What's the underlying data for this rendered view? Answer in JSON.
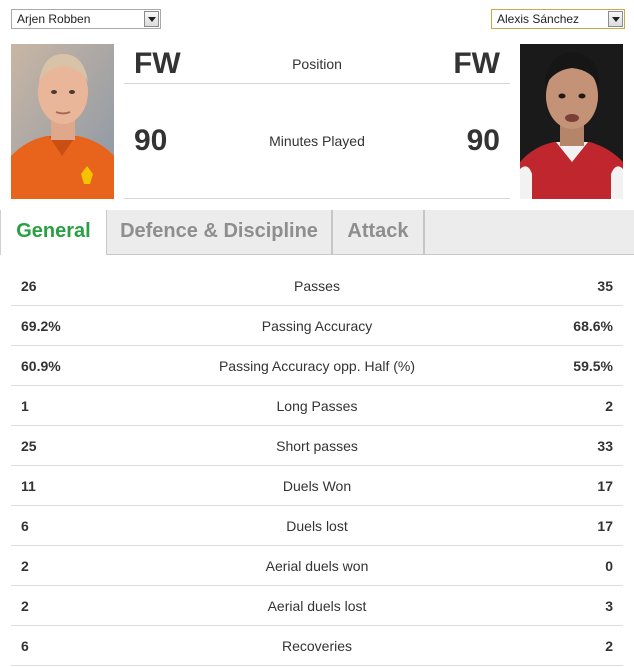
{
  "players": {
    "left": {
      "name": "Arjen Robben"
    },
    "right": {
      "name": "Alexis Sánchez"
    }
  },
  "comparison": [
    {
      "label": "Position",
      "left": "FW",
      "right": "FW"
    },
    {
      "label": "Minutes Played",
      "left": "90",
      "right": "90"
    }
  ],
  "tabs": [
    {
      "label": "General",
      "active": true
    },
    {
      "label": "Defence & Discipline",
      "active": false
    },
    {
      "label": "Attack",
      "active": false
    }
  ],
  "stats": [
    {
      "label": "Passes",
      "left": "26",
      "right": "35"
    },
    {
      "label": "Passing Accuracy",
      "left": "69.2%",
      "right": "68.6%"
    },
    {
      "label": "Passing Accuracy opp. Half (%)",
      "left": "60.9%",
      "right": "59.5%"
    },
    {
      "label": "Long Passes",
      "left": "1",
      "right": "2"
    },
    {
      "label": "Short passes",
      "left": "25",
      "right": "33"
    },
    {
      "label": "Duels Won",
      "left": "11",
      "right": "17"
    },
    {
      "label": "Duels lost",
      "left": "6",
      "right": "17"
    },
    {
      "label": "Aerial duels won",
      "left": "2",
      "right": "0"
    },
    {
      "label": "Aerial duels lost",
      "left": "2",
      "right": "3"
    },
    {
      "label": "Recoveries",
      "left": "6",
      "right": "2"
    }
  ],
  "colors": {
    "active_tab": "#29a043",
    "inactive_tab": "#8e8e8e",
    "left_jersey": "#e8641c",
    "right_jersey": "#c0262d"
  }
}
